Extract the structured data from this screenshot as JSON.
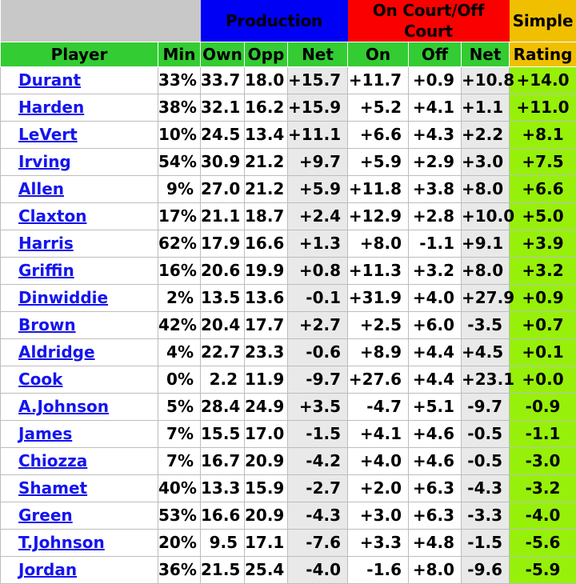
{
  "table": {
    "group_headers": [
      {
        "label": "",
        "name": "blank",
        "span": 2
      },
      {
        "label": "Production",
        "name": "production",
        "span": 3
      },
      {
        "label": "On Court/Off Court",
        "name": "oncourt-offcourt",
        "span": 3
      },
      {
        "label": "Simple",
        "name": "simple",
        "span": 1
      }
    ],
    "columns": [
      {
        "label": "Player",
        "key": "player"
      },
      {
        "label": "Min",
        "key": "min"
      },
      {
        "label": "Own",
        "key": "own"
      },
      {
        "label": "Opp",
        "key": "opp"
      },
      {
        "label": "Net",
        "key": "prod_net"
      },
      {
        "label": "On",
        "key": "on"
      },
      {
        "label": "Off",
        "key": "off"
      },
      {
        "label": "Net",
        "key": "court_net"
      },
      {
        "label": "Rating",
        "key": "rating"
      }
    ],
    "rows": [
      {
        "player": "Durant",
        "min": "33%",
        "own": "33.7",
        "opp": "18.0",
        "prod_net": "+15.7",
        "on": "+11.7",
        "off": "+0.9",
        "court_net": "+10.8",
        "rating": "+14.0"
      },
      {
        "player": "Harden",
        "min": "38%",
        "own": "32.1",
        "opp": "16.2",
        "prod_net": "+15.9",
        "on": "+5.2",
        "off": "+4.1",
        "court_net": "+1.1",
        "rating": "+11.0"
      },
      {
        "player": "LeVert",
        "min": "10%",
        "own": "24.5",
        "opp": "13.4",
        "prod_net": "+11.1",
        "on": "+6.6",
        "off": "+4.3",
        "court_net": "+2.2",
        "rating": "+8.1"
      },
      {
        "player": "Irving",
        "min": "54%",
        "own": "30.9",
        "opp": "21.2",
        "prod_net": "+9.7",
        "on": "+5.9",
        "off": "+2.9",
        "court_net": "+3.0",
        "rating": "+7.5"
      },
      {
        "player": "Allen",
        "min": "9%",
        "own": "27.0",
        "opp": "21.2",
        "prod_net": "+5.9",
        "on": "+11.8",
        "off": "+3.8",
        "court_net": "+8.0",
        "rating": "+6.6"
      },
      {
        "player": "Claxton",
        "min": "17%",
        "own": "21.1",
        "opp": "18.7",
        "prod_net": "+2.4",
        "on": "+12.9",
        "off": "+2.8",
        "court_net": "+10.0",
        "rating": "+5.0"
      },
      {
        "player": "Harris",
        "min": "62%",
        "own": "17.9",
        "opp": "16.6",
        "prod_net": "+1.3",
        "on": "+8.0",
        "off": "-1.1",
        "court_net": "+9.1",
        "rating": "+3.9"
      },
      {
        "player": "Griffin",
        "min": "16%",
        "own": "20.6",
        "opp": "19.9",
        "prod_net": "+0.8",
        "on": "+11.3",
        "off": "+3.2",
        "court_net": "+8.0",
        "rating": "+3.2"
      },
      {
        "player": "Dinwiddie",
        "min": "2%",
        "own": "13.5",
        "opp": "13.6",
        "prod_net": "-0.1",
        "on": "+31.9",
        "off": "+4.0",
        "court_net": "+27.9",
        "rating": "+0.9"
      },
      {
        "player": "Brown",
        "min": "42%",
        "own": "20.4",
        "opp": "17.7",
        "prod_net": "+2.7",
        "on": "+2.5",
        "off": "+6.0",
        "court_net": "-3.5",
        "rating": "+0.7"
      },
      {
        "player": "Aldridge",
        "min": "4%",
        "own": "22.7",
        "opp": "23.3",
        "prod_net": "-0.6",
        "on": "+8.9",
        "off": "+4.4",
        "court_net": "+4.5",
        "rating": "+0.1"
      },
      {
        "player": "Cook",
        "min": "0%",
        "own": "2.2",
        "opp": "11.9",
        "prod_net": "-9.7",
        "on": "+27.6",
        "off": "+4.4",
        "court_net": "+23.1",
        "rating": "+0.0"
      },
      {
        "player": "A.Johnson",
        "min": "5%",
        "own": "28.4",
        "opp": "24.9",
        "prod_net": "+3.5",
        "on": "-4.7",
        "off": "+5.1",
        "court_net": "-9.7",
        "rating": "-0.9"
      },
      {
        "player": "James",
        "min": "7%",
        "own": "15.5",
        "opp": "17.0",
        "prod_net": "-1.5",
        "on": "+4.1",
        "off": "+4.6",
        "court_net": "-0.5",
        "rating": "-1.1"
      },
      {
        "player": "Chiozza",
        "min": "7%",
        "own": "16.7",
        "opp": "20.9",
        "prod_net": "-4.2",
        "on": "+4.0",
        "off": "+4.6",
        "court_net": "-0.5",
        "rating": "-3.0"
      },
      {
        "player": "Shamet",
        "min": "40%",
        "own": "13.3",
        "opp": "15.9",
        "prod_net": "-2.7",
        "on": "+2.0",
        "off": "+6.3",
        "court_net": "-4.3",
        "rating": "-3.2"
      },
      {
        "player": "Green",
        "min": "53%",
        "own": "16.6",
        "opp": "20.9",
        "prod_net": "-4.3",
        "on": "+3.0",
        "off": "+6.3",
        "court_net": "-3.3",
        "rating": "-4.0"
      },
      {
        "player": "T.Johnson",
        "min": "20%",
        "own": "9.5",
        "opp": "17.1",
        "prod_net": "-7.6",
        "on": "+3.3",
        "off": "+4.8",
        "court_net": "-1.5",
        "rating": "-5.6"
      },
      {
        "player": "Jordan",
        "min": "36%",
        "own": "21.5",
        "opp": "25.4",
        "prod_net": "-4.0",
        "on": "-1.6",
        "off": "+8.0",
        "court_net": "-9.6",
        "rating": "-5.9"
      }
    ]
  },
  "colors": {
    "header_green": "#33cc33",
    "production_blue": "#0000f5",
    "oncourt_red": "#fb0000",
    "simple_gold": "#f0c000",
    "rating_green": "#96f00a",
    "net_gray": "#e9e9e9",
    "top_left_gray": "#c8c8c8",
    "link_blue": "#1414ee"
  }
}
